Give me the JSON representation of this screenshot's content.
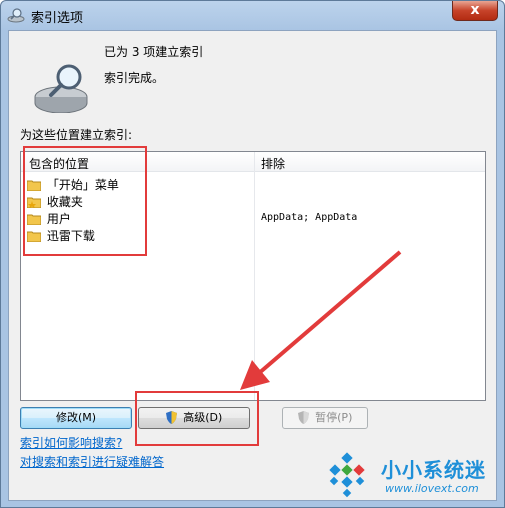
{
  "window": {
    "title": "索引选项",
    "close_glyph": "x"
  },
  "status": {
    "count": "已为 3 项建立索引",
    "done": "索引完成。"
  },
  "section_label": "为这些位置建立索引:",
  "list": {
    "columns": {
      "included": "包含的位置",
      "exclude": "排除"
    },
    "rows": [
      {
        "label": "「开始」菜单",
        "icon": "start-menu-folder-icon"
      },
      {
        "label": "收藏夹",
        "icon": "favorites-folder-icon"
      },
      {
        "label": "用户",
        "icon": "folder-icon"
      },
      {
        "label": "迅雷下载",
        "icon": "folder-icon"
      }
    ],
    "exclude_value": "AppData; AppData"
  },
  "buttons": {
    "modify": "修改(M)",
    "advanced": "高级(D)",
    "pause": "暂停(P)"
  },
  "links": {
    "affect_search": "索引如何影响搜索?",
    "troubleshoot": "对搜索和索引进行疑难解答"
  },
  "watermark": {
    "name": "小小系统迷",
    "url": "www.ilovext.com"
  },
  "colors": {
    "annotation": "#e23b3b",
    "link": "#0066cc",
    "watermark": "#1e8fd8"
  }
}
